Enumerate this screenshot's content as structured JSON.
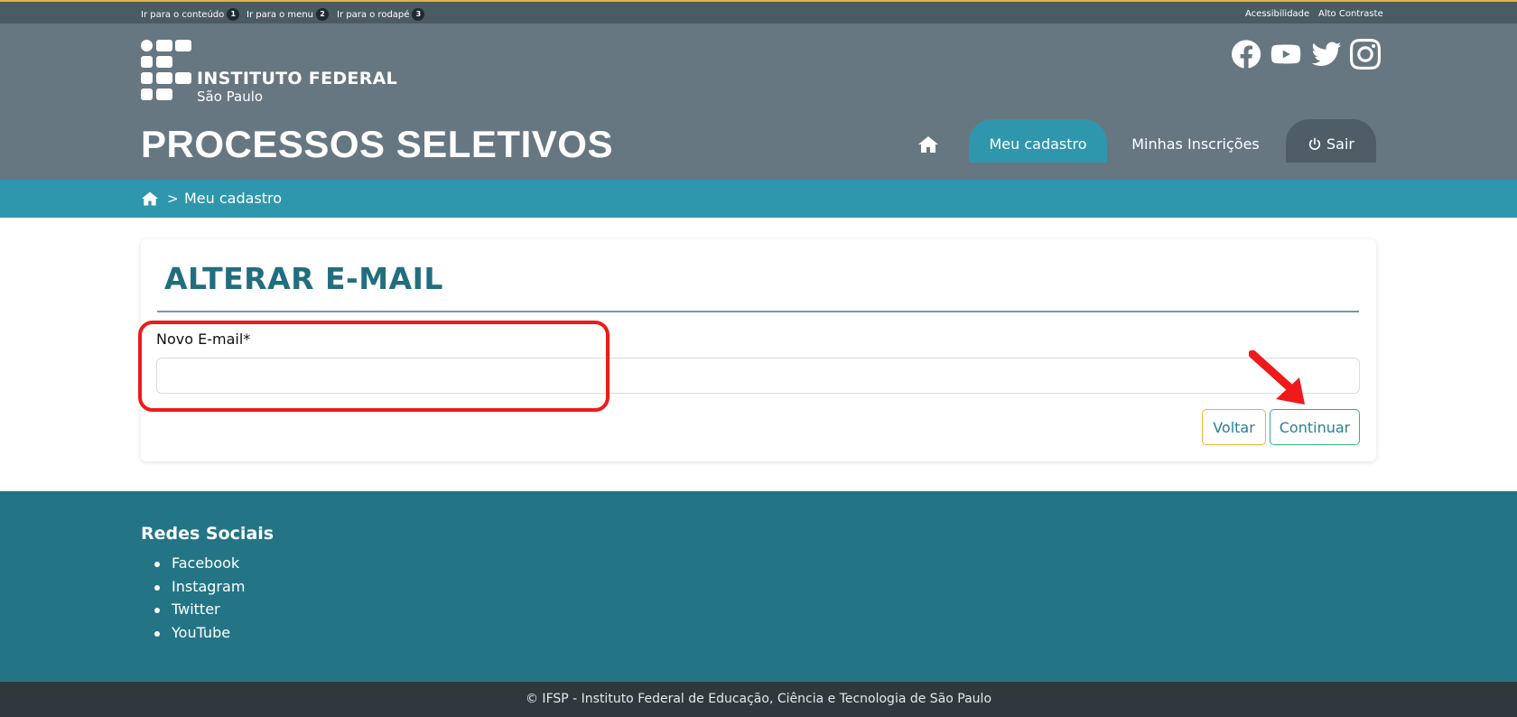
{
  "topbar": {
    "skip_links": [
      {
        "label": "Ir para o conteúdo",
        "num": "1"
      },
      {
        "label": "Ir para o menu",
        "num": "2"
      },
      {
        "label": "Ir para o rodapé",
        "num": "3"
      }
    ],
    "accessibility": "Acessibilidade",
    "contrast": "Alto Contraste"
  },
  "header": {
    "logo_title": "INSTITUTO FEDERAL",
    "logo_subtitle": "São Paulo",
    "site_title": "PROCESSOS SELETIVOS",
    "social_icons": [
      "facebook-icon",
      "youtube-icon",
      "twitter-icon",
      "instagram-icon"
    ]
  },
  "nav": {
    "home_icon": "home-icon",
    "items": [
      {
        "label": "Meu cadastro",
        "active": true
      },
      {
        "label": "Minhas Inscrições",
        "active": false
      }
    ],
    "logout_label": "Sair"
  },
  "breadcrumb": {
    "separator": ">",
    "current": "Meu cadastro"
  },
  "form": {
    "title": "ALTERAR E-MAIL",
    "email_label": "Novo E-mail*",
    "email_value": "",
    "back_label": "Voltar",
    "continue_label": "Continuar"
  },
  "footer": {
    "social_title": "Redes Sociais",
    "social_links": [
      "Facebook",
      "Instagram",
      "Twitter",
      "YouTube"
    ],
    "copyright": "© IFSP - Instituto Federal de Educação, Ciência e Tecnologia de São Paulo"
  },
  "colors": {
    "header_bg": "#667781",
    "topbar_bg": "#4b5b64",
    "accent": "#2e97ad",
    "footer_bg": "#237585",
    "title_color": "#216e7e",
    "annotation_red": "#ef1a1a"
  }
}
